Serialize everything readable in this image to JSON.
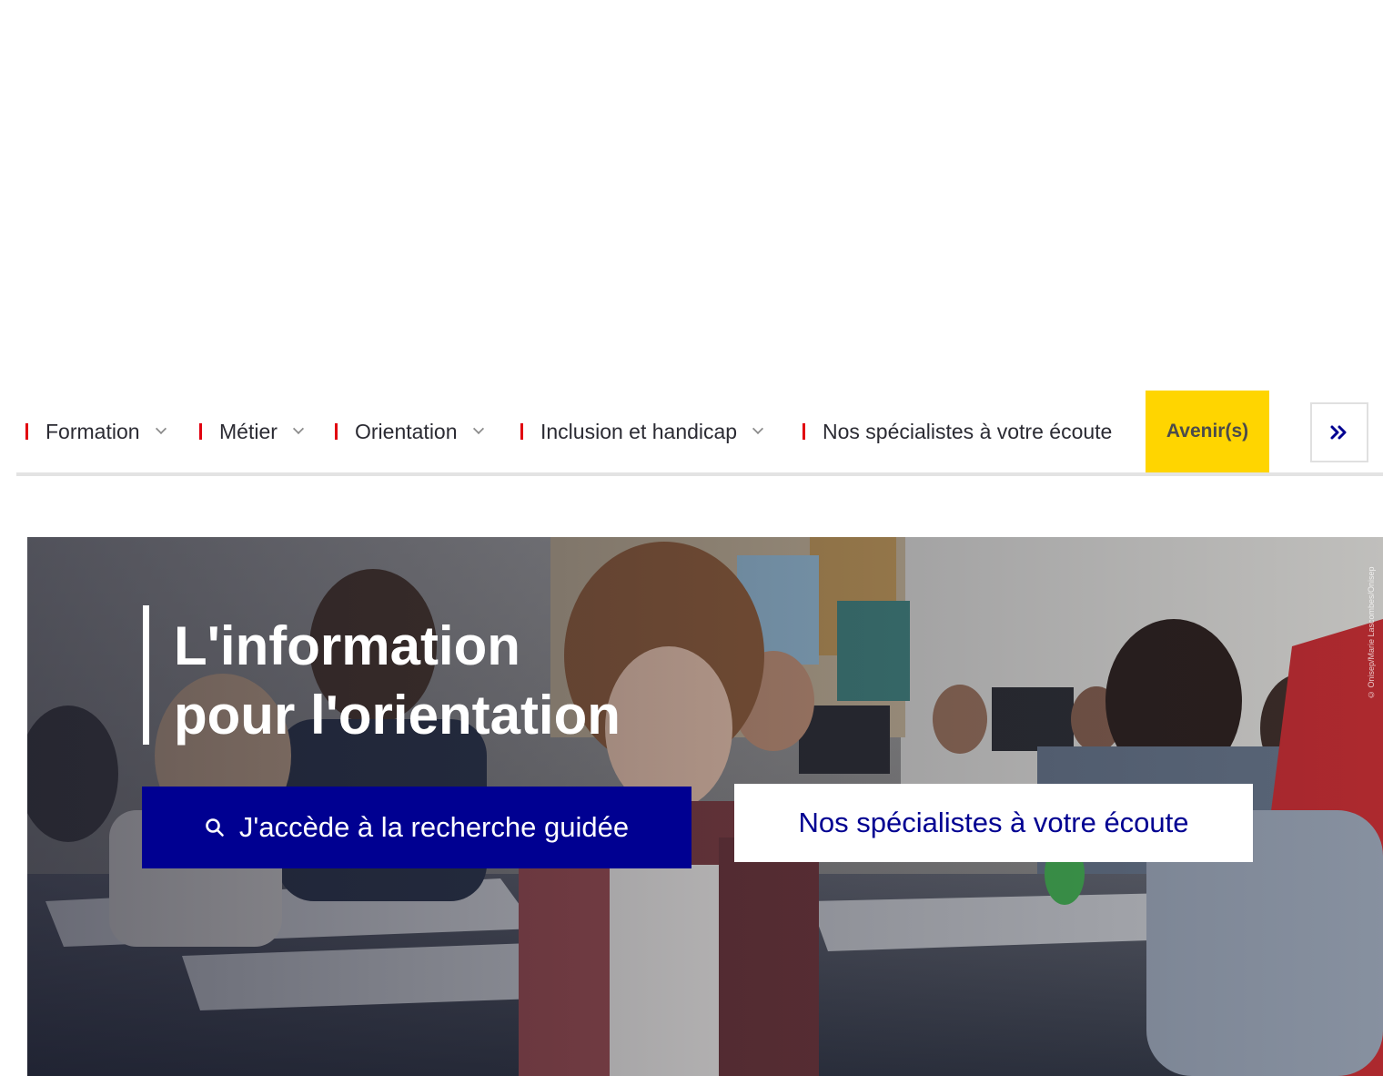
{
  "nav": {
    "items": [
      {
        "label": "Formation",
        "has_dropdown": true
      },
      {
        "label": "Métier",
        "has_dropdown": true
      },
      {
        "label": "Orientation",
        "has_dropdown": true
      },
      {
        "label": "Inclusion et handicap",
        "has_dropdown": true
      },
      {
        "label": "Nos spécialistes à votre écoute",
        "has_dropdown": false
      }
    ],
    "highlight": {
      "label": "Avenir(s)",
      "color": "#ffd500"
    },
    "more_icon": "double-chevron-right-icon",
    "divider_color": "#e1000f",
    "dropdown_icon": "chevron-down-icon"
  },
  "hero": {
    "title_line1": "L'information",
    "title_line2": "pour l'orientation",
    "search_button": {
      "label": "J'accède à la recherche guidée",
      "icon": "search-icon",
      "color": "#000091"
    },
    "specialists_button": {
      "label": "Nos spécialistes à votre écoute"
    },
    "photo_credit": "© Onisep/Marie Lascombes/Onisep"
  }
}
